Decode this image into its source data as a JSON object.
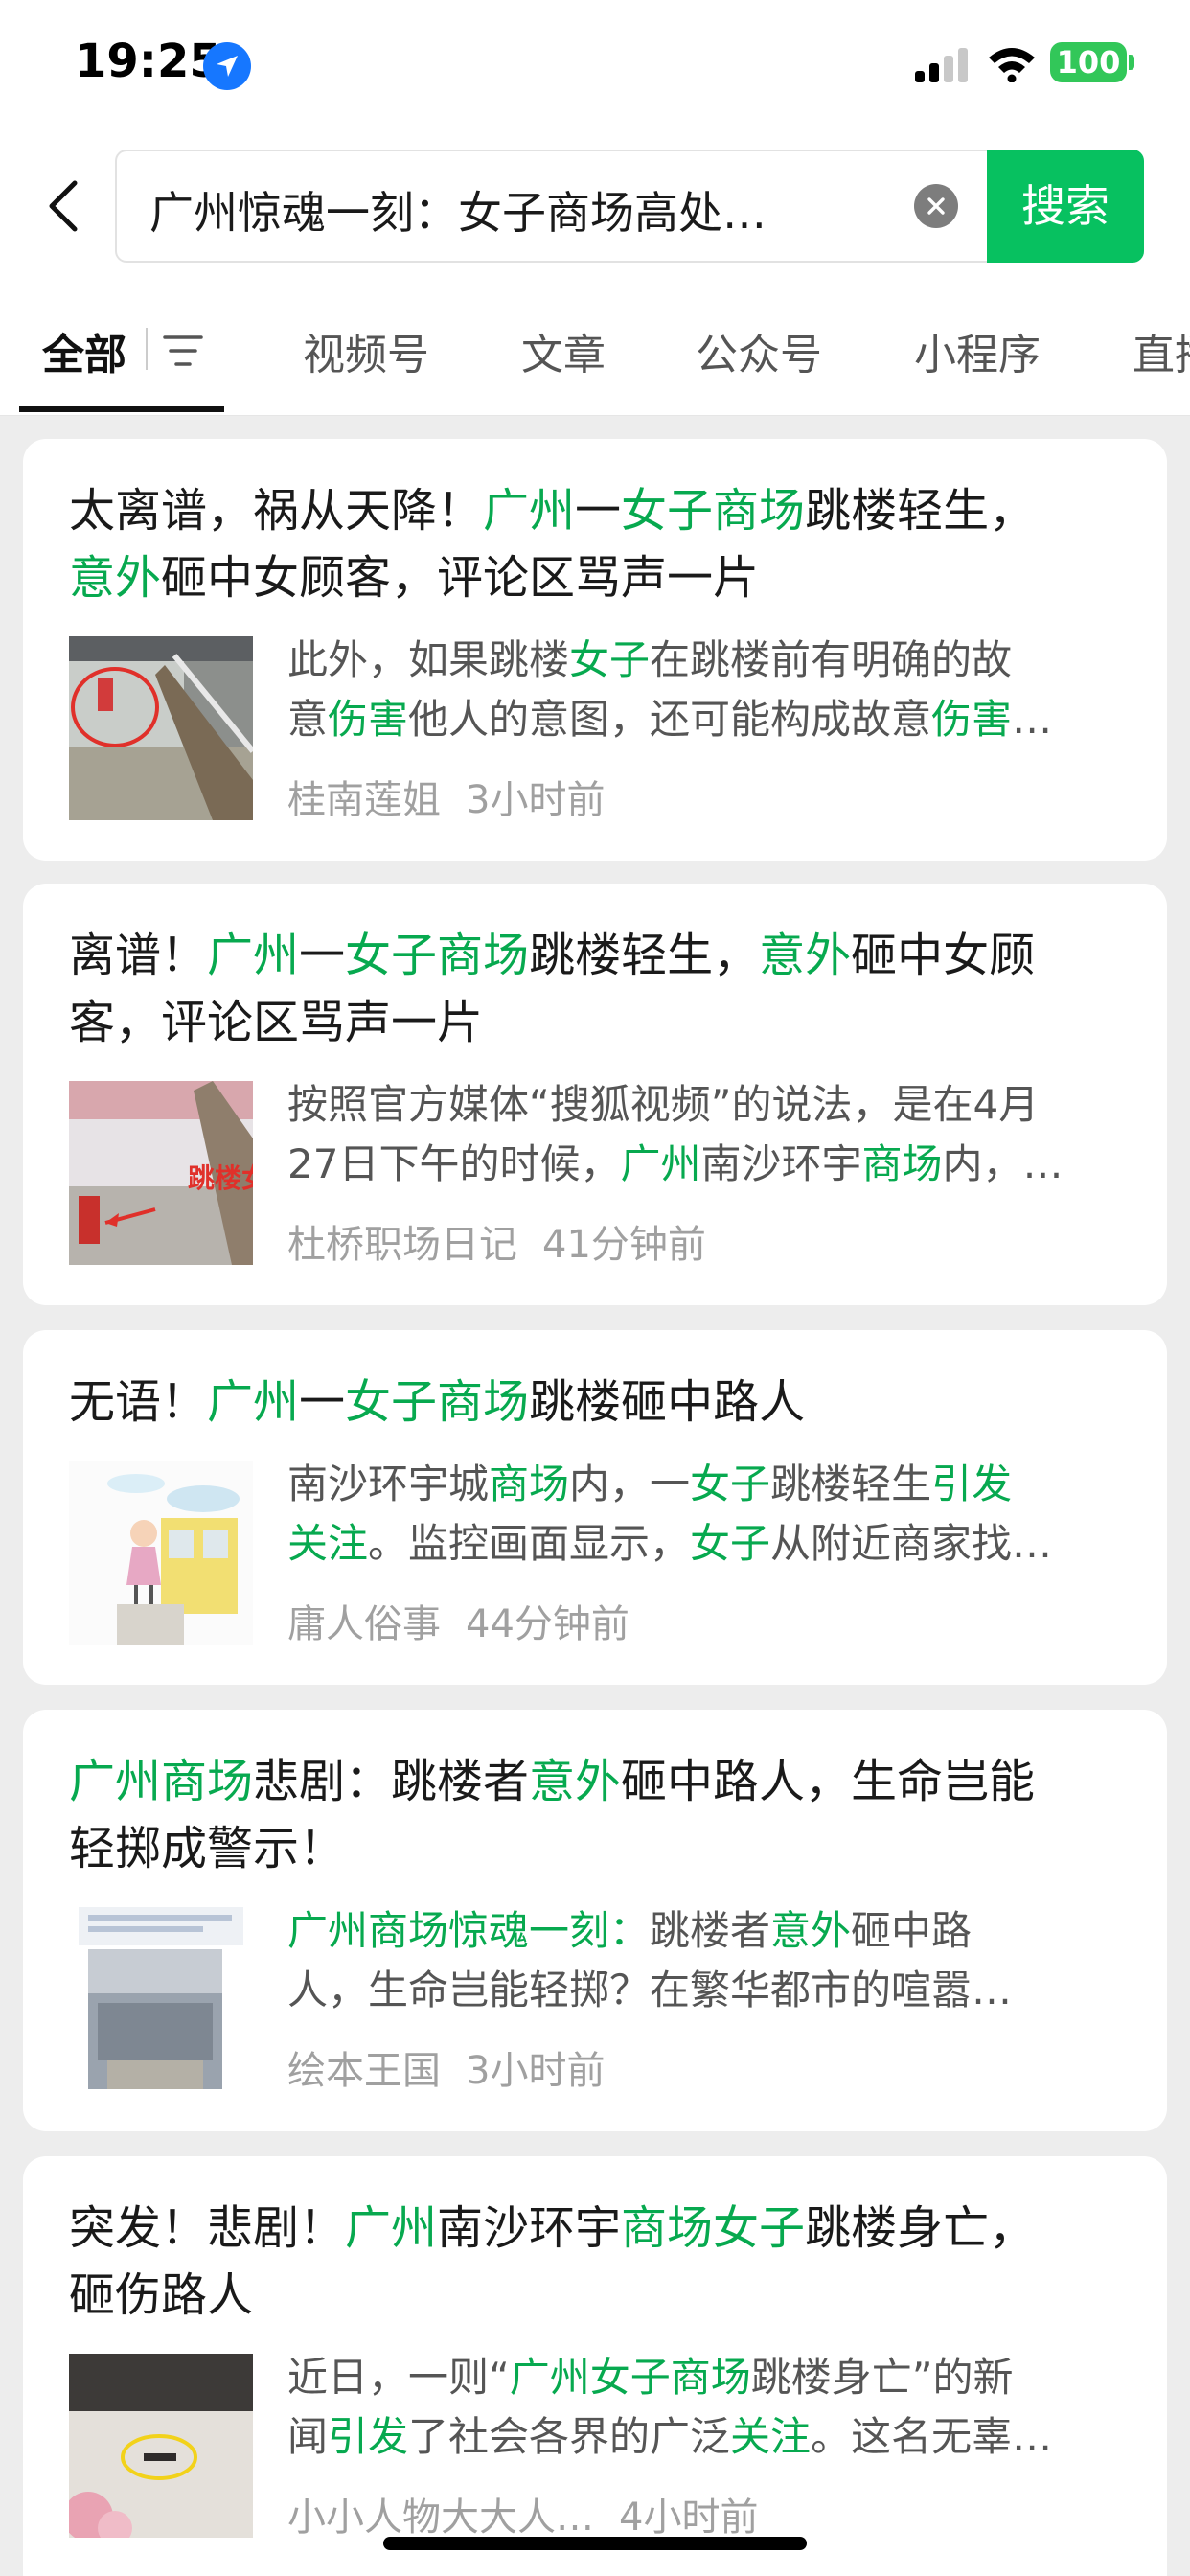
{
  "status_bar": {
    "time": "19:25",
    "battery": "100"
  },
  "search": {
    "query": "广州惊魂一刻：女子商场高处…",
    "button": "搜索"
  },
  "tabs": [
    "全部",
    "视频号",
    "文章",
    "公众号",
    "小程序",
    "直播"
  ],
  "colors": {
    "accent": "#07c160",
    "highlight": "#07a94f"
  },
  "results": [
    {
      "title": [
        [
          [
            "太离谱，祸从天降！",
            false
          ],
          [
            "广州",
            true
          ],
          [
            "一",
            false
          ],
          [
            "女子商场",
            true
          ],
          [
            "跳楼轻生，",
            false
          ]
        ],
        [
          [
            "意外",
            true
          ],
          [
            "砸中女顾客，评论区骂声一片",
            false
          ]
        ]
      ],
      "snippet": [
        [
          [
            "此外，如果跳楼",
            false
          ],
          [
            "女子",
            true
          ],
          [
            "在跳楼前有明确的故",
            false
          ]
        ],
        [
          [
            "意",
            false
          ],
          [
            "伤害",
            true
          ],
          [
            "他人的意图，还可能构成故意",
            false
          ],
          [
            "伤害",
            true
          ],
          [
            "…",
            false
          ]
        ]
      ],
      "source": "桂南莲姐",
      "time": "3小时前"
    },
    {
      "title": [
        [
          [
            "离谱！",
            false
          ],
          [
            "广州",
            true
          ],
          [
            "一",
            false
          ],
          [
            "女子商场",
            true
          ],
          [
            "跳楼轻生，",
            false
          ],
          [
            "意外",
            true
          ],
          [
            "砸中女顾",
            false
          ]
        ],
        [
          [
            "客，评论区骂声一片",
            false
          ]
        ]
      ],
      "snippet": [
        [
          [
            "按照官方媒体“搜狐视频”的说法，是在4月",
            false
          ]
        ],
        [
          [
            "27日下午的时候，",
            false
          ],
          [
            "广州",
            true
          ],
          [
            "南沙环宇",
            false
          ],
          [
            "商场",
            true
          ],
          [
            "内，…",
            false
          ]
        ]
      ],
      "thumb_text": "跳楼女子",
      "source": "杜桥职场日记",
      "time": "41分钟前"
    },
    {
      "title": [
        [
          [
            "无语！",
            false
          ],
          [
            "广州",
            true
          ],
          [
            "一",
            false
          ],
          [
            "女子商场",
            true
          ],
          [
            "跳楼砸中路人",
            false
          ]
        ]
      ],
      "snippet": [
        [
          [
            "南沙环宇城",
            false
          ],
          [
            "商场",
            true
          ],
          [
            "内，一",
            false
          ],
          [
            "女子",
            true
          ],
          [
            "跳楼轻生",
            false
          ],
          [
            "引发",
            true
          ]
        ],
        [
          [
            "关注",
            true
          ],
          [
            "。监控画面显示，",
            false
          ],
          [
            "女子",
            true
          ],
          [
            "从附近商家找…",
            false
          ]
        ]
      ],
      "source": "庸人俗事",
      "time": "44分钟前"
    },
    {
      "title": [
        [
          [
            "广州商场",
            true
          ],
          [
            "悲剧：跳楼者",
            false
          ],
          [
            "意外",
            true
          ],
          [
            "砸中路人，生命岂能",
            false
          ]
        ],
        [
          [
            "轻掷成警示！",
            false
          ]
        ]
      ],
      "snippet": [
        [
          [
            "广州商场惊魂一刻：",
            true
          ],
          [
            "跳楼者",
            false
          ],
          [
            "意外",
            true
          ],
          [
            "砸中路",
            false
          ]
        ],
        [
          [
            "人，生命岂能轻掷？在繁华都市的喧嚣…",
            false
          ]
        ]
      ],
      "source": "绘本王国",
      "time": "3小时前"
    },
    {
      "title": [
        [
          [
            "突发！悲剧！",
            false
          ],
          [
            "广州",
            true
          ],
          [
            "南沙环宇",
            false
          ],
          [
            "商场女子",
            true
          ],
          [
            "跳楼身亡，",
            false
          ]
        ],
        [
          [
            "砸伤路人",
            false
          ]
        ]
      ],
      "snippet": [
        [
          [
            "近日，一则“",
            false
          ],
          [
            "广州女子商场",
            true
          ],
          [
            "跳楼身亡”的新",
            false
          ]
        ],
        [
          [
            "闻",
            false
          ],
          [
            "引发",
            true
          ],
          [
            "了社会各界的广泛",
            false
          ],
          [
            "关注",
            true
          ],
          [
            "。这名无辜…",
            false
          ]
        ]
      ],
      "source": "小小人物大大人…",
      "time": "4小时前"
    }
  ]
}
